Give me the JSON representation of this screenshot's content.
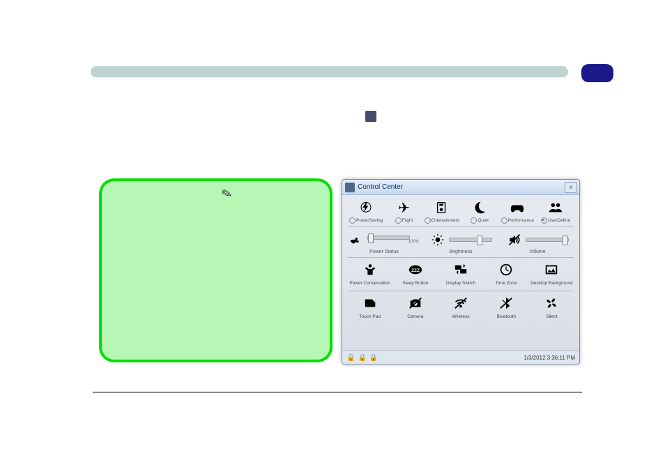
{
  "window": {
    "title": "Control Center",
    "close": "x",
    "datetime": "1/3/2012 3:36:11 PM"
  },
  "modes": [
    {
      "id": "powersaving",
      "label": "PowerSaving",
      "selected": false
    },
    {
      "id": "flight",
      "label": "Flight",
      "selected": false
    },
    {
      "id": "entertainment",
      "label": "Entertainment",
      "selected": false
    },
    {
      "id": "quiet",
      "label": "Quiet",
      "selected": false
    },
    {
      "id": "performance",
      "label": "Performance",
      "selected": false
    },
    {
      "id": "userdefine",
      "label": "UserDefine",
      "selected": true
    }
  ],
  "sliders": {
    "power": {
      "label": "Power Status",
      "min": "0%",
      "max": "100%",
      "pos": 5
    },
    "brightness": {
      "label": "Brightness",
      "pos": 70
    },
    "volume": {
      "label": "Volume",
      "pos": 95
    }
  },
  "utils_row1": [
    {
      "id": "power-conservation",
      "label": "Power Conservation"
    },
    {
      "id": "sleep-button",
      "label": "Sleep Button"
    },
    {
      "id": "display-switch",
      "label": "Display Switch"
    },
    {
      "id": "time-zone",
      "label": "Time Zone"
    },
    {
      "id": "desktop-background",
      "label": "Desktop Background"
    }
  ],
  "utils_row2": [
    {
      "id": "touch-pad",
      "label": "Touch Pad"
    },
    {
      "id": "camera",
      "label": "Camera"
    },
    {
      "id": "wireless",
      "label": "Wireless"
    },
    {
      "id": "bluetooth",
      "label": "Bluetooth"
    },
    {
      "id": "silent",
      "label": "Silent"
    }
  ]
}
